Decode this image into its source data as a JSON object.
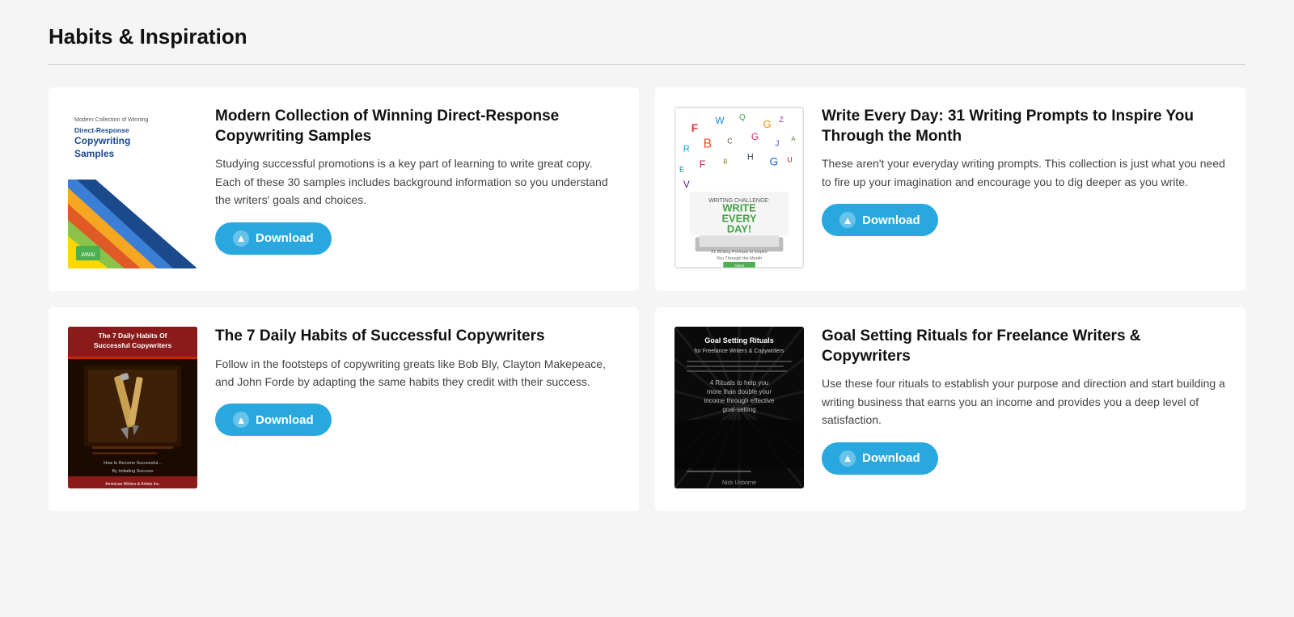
{
  "section": {
    "title": "Habits & Inspiration"
  },
  "cards": [
    {
      "id": "copywriting-samples",
      "title": "Modern Collection of Winning Direct-Response Copywriting Samples",
      "description": "Studying successful promotions is a key part of learning to write great copy. Each of these 30 samples includes background information so you understand the writers' goals and choices.",
      "button_label": "Download",
      "cover_type": "copywriting"
    },
    {
      "id": "write-every-day",
      "title": "Write Every Day: 31 Writing Prompts to Inspire You Through the Month",
      "description": "These aren't your everyday writing prompts. This collection is just what you need to fire up your imagination and encourage you to dig deeper as you write.",
      "button_label": "Download",
      "cover_type": "write"
    },
    {
      "id": "daily-habits",
      "title": "The 7 Daily Habits of Successful Copywriters",
      "description": "Follow in the footsteps of copywriting greats like Bob Bly, Clayton Makepeace, and John Forde by adapting the same habits they credit with their success.",
      "button_label": "Download",
      "cover_type": "habits"
    },
    {
      "id": "goal-setting",
      "title": "Goal Setting Rituals for Freelance Writers & Copywriters",
      "description": "Use these four rituals to establish your purpose and direction and start building a writing business that earns you an income and provides you a deep level of satisfaction.",
      "button_label": "Download",
      "cover_type": "goals"
    }
  ]
}
